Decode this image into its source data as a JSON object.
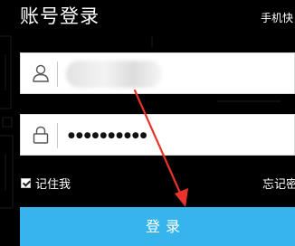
{
  "header": {
    "title": "账号登录",
    "switch_link": "手机快"
  },
  "account_field": {
    "icon": "user-icon",
    "value_obscured": true
  },
  "password_field": {
    "icon": "lock-icon",
    "masked_value": "●●●●●●●●●●"
  },
  "options": {
    "remember_label": "记住我",
    "remember_checked": true,
    "forgot_label": "忘记密"
  },
  "login_button": {
    "label": "登录"
  },
  "annotation": {
    "arrow_color": "#e8332a"
  },
  "colors": {
    "background": "#000000",
    "button": "#36b4ec",
    "text_on_dark": "#ffffff"
  }
}
